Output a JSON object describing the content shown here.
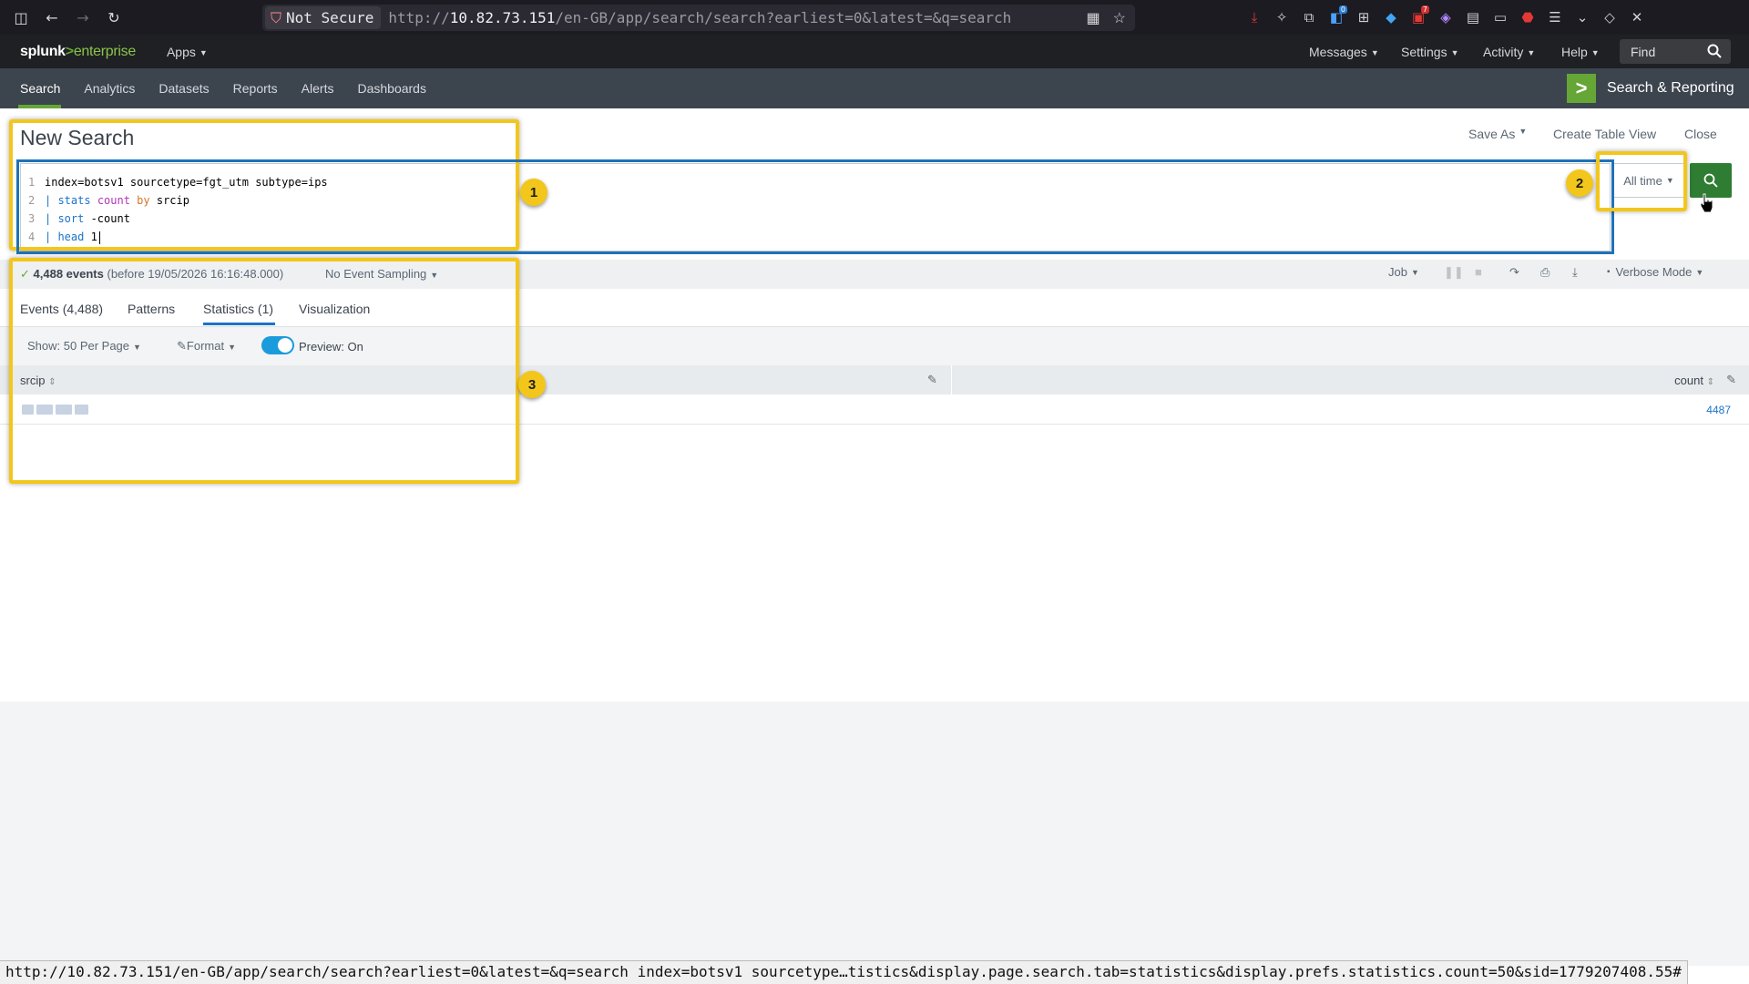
{
  "browser": {
    "not_secure": "Not Secure",
    "url_prefix": "http://",
    "url_host": "10.82.73.151",
    "url_rest": "/en-GB/app/search/search?earliest=0&latest=&q=search",
    "status_url": "http://10.82.73.151/en-GB/app/search/search?earliest=0&latest=&q=search index=botsv1 sourcetype…tistics&display.page.search.tab=statistics&display.prefs.statistics.count=50&sid=1779207408.55#",
    "ext_badge_blue": "0",
    "ext_badge_red": "7"
  },
  "topbar": {
    "logo_a": "splunk",
    "logo_b": ">",
    "logo_c": "enterprise",
    "apps": "Apps",
    "messages": "Messages",
    "settings": "Settings",
    "activity": "Activity",
    "help": "Help",
    "find_placeholder": "Find"
  },
  "nav": {
    "items": [
      "Search",
      "Analytics",
      "Datasets",
      "Reports",
      "Alerts",
      "Dashboards"
    ],
    "app_title": "Search & Reporting"
  },
  "page": {
    "title": "New Search",
    "save_as": "Save As",
    "create_table": "Create Table View",
    "close": "Close"
  },
  "query": {
    "lines": [
      {
        "n": "1",
        "text": "index=botsv1 sourcetype=fgt_utm subtype=ips"
      },
      {
        "n": "2",
        "pipe": "| ",
        "cmd": "stats",
        "fn": "count",
        "by": "by",
        "field": "srcip"
      },
      {
        "n": "3",
        "pipe": "| ",
        "cmd": "sort",
        "rest": " -count"
      },
      {
        "n": "4",
        "pipe": "| ",
        "cmd": "head",
        "rest": " 1"
      }
    ],
    "time_range": "All time"
  },
  "status": {
    "events": "4,488 events",
    "before": "(before 19/05/2026 16:16:48.000)",
    "sampling": "No Event Sampling",
    "job": "Job",
    "mode": "Verbose Mode"
  },
  "tabs": [
    "Events (4,488)",
    "Patterns",
    "Statistics (1)",
    "Visualization"
  ],
  "toolbar": {
    "show": "Show: 50 Per Page",
    "format": "Format",
    "preview": "Preview: On"
  },
  "table": {
    "columns": [
      "srcip",
      "count"
    ],
    "rows": [
      {
        "srcip": "",
        "count": "4487"
      }
    ]
  },
  "annotations": [
    "1",
    "2",
    "3"
  ],
  "colors": {
    "highlight": "#f3c61b",
    "accent_green": "#65a637",
    "link_blue": "#1a73c9"
  }
}
